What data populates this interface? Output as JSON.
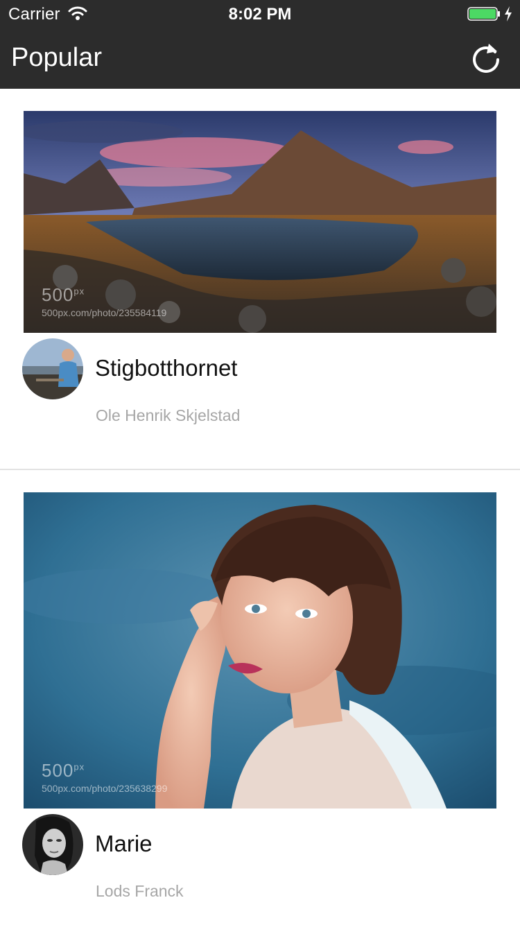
{
  "status_bar": {
    "carrier": "Carrier",
    "time": "8:02 PM",
    "battery_color": "#4cd964"
  },
  "nav": {
    "title": "Popular",
    "refresh_icon": "refresh-icon"
  },
  "posts": [
    {
      "title": "Stigbotthornet",
      "author": "Ole Henrik Skjelstad",
      "watermark_logo": "500",
      "watermark_logo_sup": "px",
      "watermark_url": "500px.com/photo/235584119"
    },
    {
      "title": "Marie",
      "author": "Lods Franck",
      "watermark_logo": "500",
      "watermark_logo_sup": "px",
      "watermark_url": "500px.com/photo/235638299"
    }
  ]
}
